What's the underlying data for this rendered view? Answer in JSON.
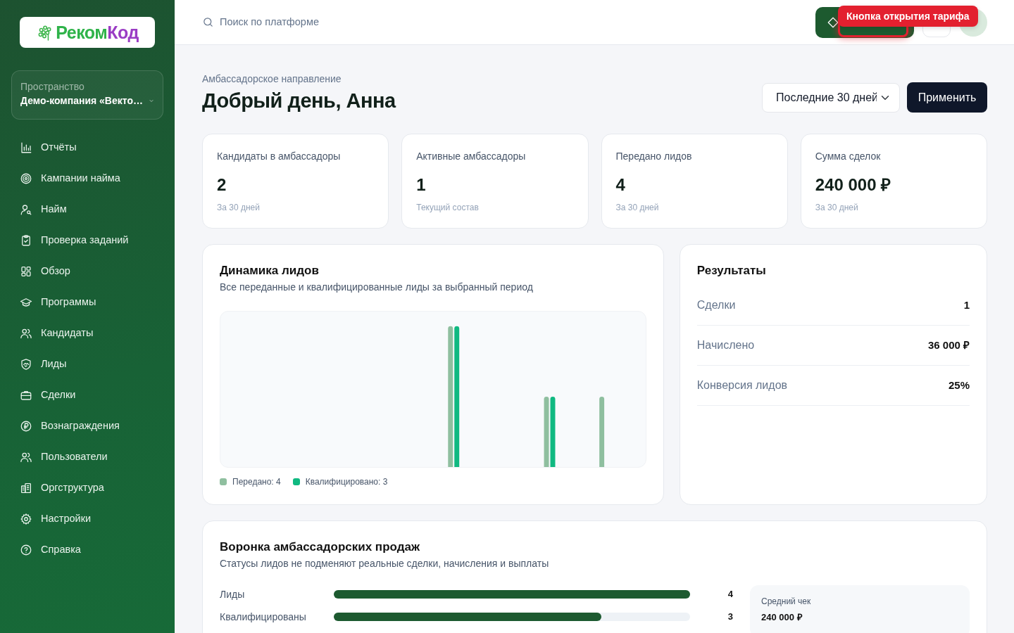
{
  "sidebar": {
    "logo": {
      "primary": "Реком",
      "accent": "Код"
    },
    "workspace": {
      "label": "Пространство",
      "value": "Демо-компания «Векто…"
    },
    "nav": [
      {
        "label": "Отчёты"
      },
      {
        "label": "Кампании найма"
      },
      {
        "label": "Найм"
      },
      {
        "label": "Проверка заданий"
      },
      {
        "label": "Обзор"
      },
      {
        "label": "Программы"
      },
      {
        "label": "Кандидаты"
      },
      {
        "label": "Лиды"
      },
      {
        "label": "Сделки"
      },
      {
        "label": "Вознаграждения"
      },
      {
        "label": "Пользователи"
      },
      {
        "label": "Оргструктура"
      },
      {
        "label": "Настройки"
      },
      {
        "label": "Справка"
      }
    ]
  },
  "header": {
    "search": {
      "placeholder": "Поиск по платформе"
    },
    "plan_button": {
      "highlighted": true
    },
    "tooltip": "Кнопка открытия тарифа"
  },
  "page": {
    "eyebrow": "Амбассадорское направление",
    "title": "Добрый день, Анна",
    "period": {
      "value": "Последние 30 дней"
    },
    "apply_button": "Применить"
  },
  "stats": [
    {
      "label": "Кандидаты в амбассадоры",
      "value": "2",
      "note": "За 30 дней"
    },
    {
      "label": "Активные амбассадоры",
      "value": "1",
      "note": "Текущий состав"
    },
    {
      "label": "Передано лидов",
      "value": "4",
      "note": "За 30 дней"
    },
    {
      "label": "Сумма сделок",
      "value": "240 000 ₽",
      "note": "За 30 дней"
    }
  ],
  "leads_chart": {
    "title": "Динамика лидов",
    "subtitle": "Все переданные и квалифицированные лиды за выбранный период",
    "legend": [
      {
        "label": "Передано: 4",
        "color": "#8fbf9f"
      },
      {
        "label": "Квалифицировано: 3",
        "color": "#10b981"
      }
    ]
  },
  "results": {
    "title": "Результаты",
    "rows": [
      {
        "label": "Сделки",
        "value": "1"
      },
      {
        "label": "Начислено",
        "value": "36 000 ₽"
      },
      {
        "label": "Конверсия лидов",
        "value": "25%"
      }
    ]
  },
  "funnel": {
    "title": "Воронка амбассадорских продаж",
    "subtitle": "Статусы лидов не подменяют реальные сделки, начисления и выплаты",
    "stages": [
      {
        "label": "Лиды",
        "level": 1,
        "value": "4"
      },
      {
        "label": "Квалифицированы",
        "level": 0.75,
        "value": "3"
      }
    ],
    "summary": {
      "label": "Средний чек",
      "value": "240 000 ₽"
    }
  }
}
